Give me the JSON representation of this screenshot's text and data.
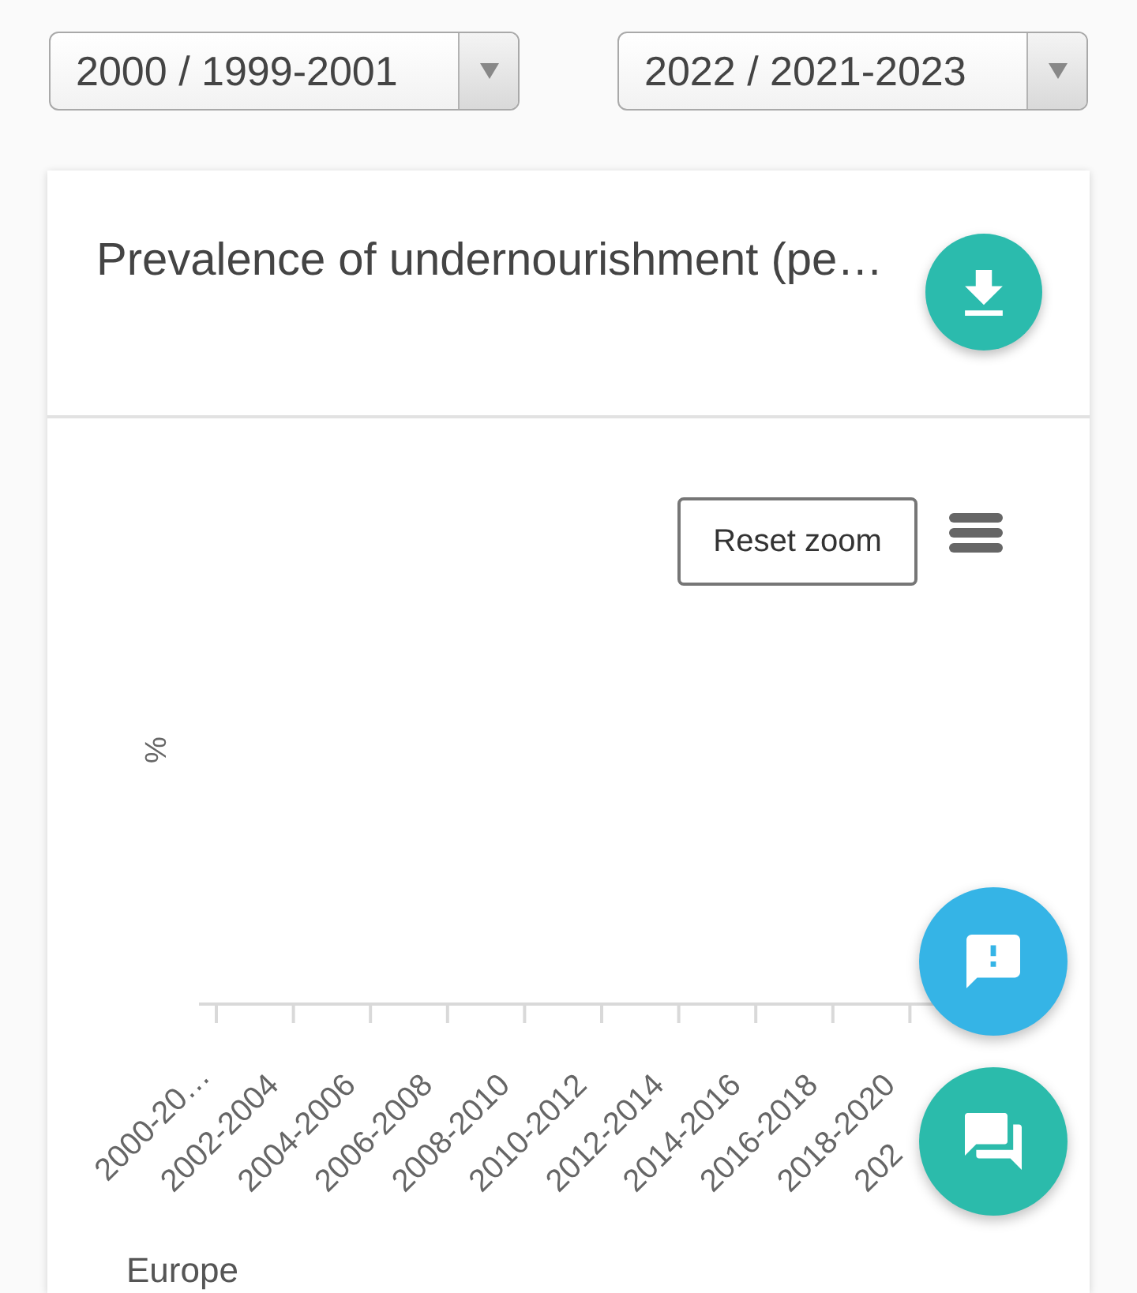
{
  "period_selects": [
    {
      "value": "2000 / 1999-2001"
    },
    {
      "value": "2022 / 2021-2023"
    }
  ],
  "chart_card": {
    "title": "Prevalence of undernourishment (pe…",
    "reset_zoom_button": "Reset zoom",
    "y_axis_title": "%",
    "x_axis_labels": [
      "2000-20…",
      "2002-2004",
      "2004-2006",
      "2006-2008",
      "2008-2010",
      "2010-2012",
      "2012-2014",
      "2014-2016",
      "2016-2018",
      "2018-2020",
      "202"
    ],
    "legend_items": [
      "Europe"
    ]
  }
}
